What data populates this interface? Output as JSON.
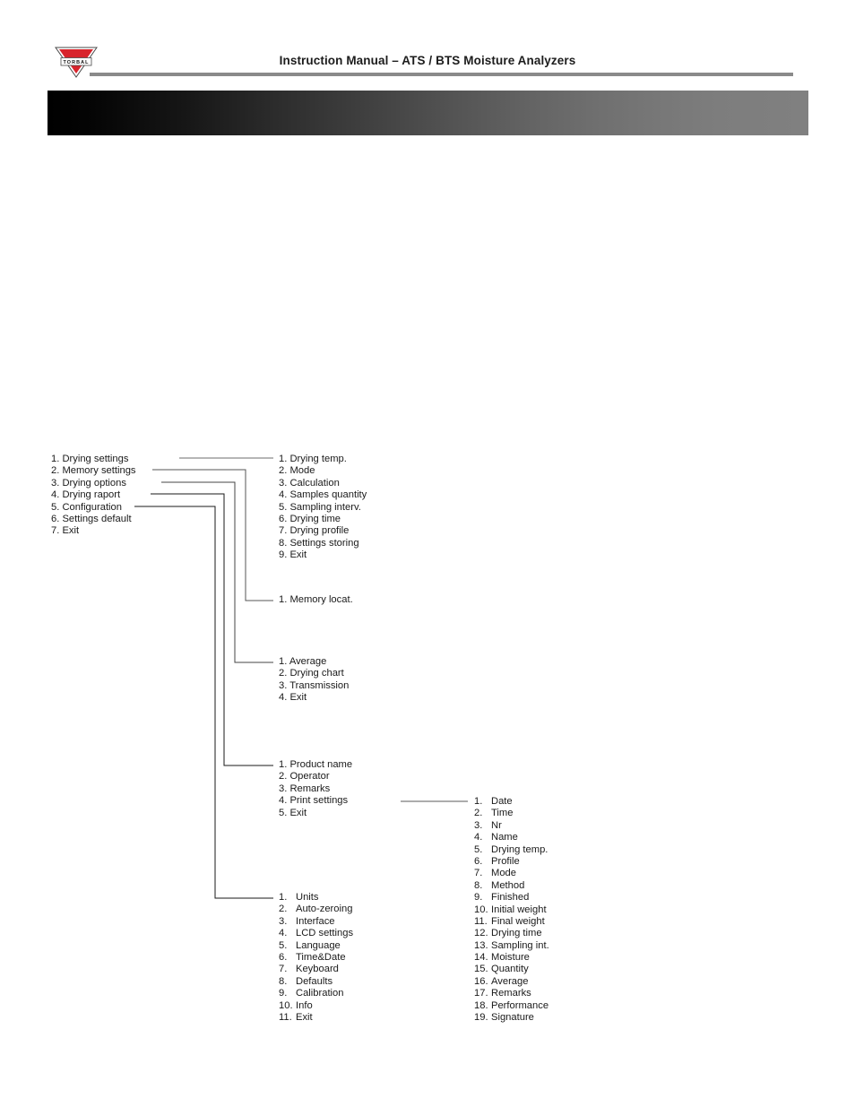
{
  "header": {
    "title": "Instruction Manual – ATS / BTS Moisture Analyzers",
    "logo_text": "TORBAL",
    "logo_color": "#d8242c",
    "rule_color": "#8a8a8a",
    "banner_gradient_from": "#000000",
    "banner_gradient_to": "#808080"
  },
  "diagram": {
    "type": "menu-tree",
    "root_menu": {
      "name": "main-menu",
      "items": [
        {
          "num": "1.",
          "label": "Drying settings"
        },
        {
          "num": "2.",
          "label": "Memory settings"
        },
        {
          "num": "3.",
          "label": "Drying options"
        },
        {
          "num": "4.",
          "label": "Drying raport"
        },
        {
          "num": "5.",
          "label": "Configuration"
        },
        {
          "num": "6.",
          "label": "Settings default"
        },
        {
          "num": "7.",
          "label": "Exit"
        }
      ]
    },
    "drying_settings": {
      "name": "drying-settings-menu",
      "items": [
        {
          "num": "1.",
          "label": "Drying temp."
        },
        {
          "num": "2.",
          "label": "Mode"
        },
        {
          "num": "3.",
          "label": "Calculation"
        },
        {
          "num": "4.",
          "label": "Samples quantity"
        },
        {
          "num": "5.",
          "label": "Sampling interv."
        },
        {
          "num": "6.",
          "label": "Drying time"
        },
        {
          "num": "7.",
          "label": "Drying profile"
        },
        {
          "num": "8.",
          "label": "Settings storing"
        },
        {
          "num": "9.",
          "label": "Exit"
        }
      ]
    },
    "memory_settings": {
      "name": "memory-settings-menu",
      "items": [
        {
          "num": "1.",
          "label": "Memory locat."
        }
      ]
    },
    "drying_options": {
      "name": "drying-options-menu",
      "items": [
        {
          "num": "1.",
          "label": "Average"
        },
        {
          "num": "2.",
          "label": "Drying chart"
        },
        {
          "num": "3.",
          "label": "Transmission"
        },
        {
          "num": "4.",
          "label": "Exit"
        }
      ]
    },
    "drying_report": {
      "name": "drying-report-menu",
      "items": [
        {
          "num": "1.",
          "label": "Product name"
        },
        {
          "num": "2.",
          "label": "Operator"
        },
        {
          "num": "3.",
          "label": "Remarks"
        },
        {
          "num": "4.",
          "label": "Print settings"
        },
        {
          "num": "5.",
          "label": "Exit"
        }
      ]
    },
    "configuration": {
      "name": "configuration-menu",
      "items": [
        {
          "num": "1.",
          "label": "Units"
        },
        {
          "num": "2.",
          "label": "Auto-zeroing"
        },
        {
          "num": "3.",
          "label": "Interface"
        },
        {
          "num": "4.",
          "label": "LCD settings"
        },
        {
          "num": "5.",
          "label": "Language"
        },
        {
          "num": "6.",
          "label": "Time&Date"
        },
        {
          "num": "7.",
          "label": "Keyboard"
        },
        {
          "num": "8.",
          "label": "Defaults"
        },
        {
          "num": "9.",
          "label": "Calibration"
        },
        {
          "num": "10.",
          "label": "Info"
        },
        {
          "num": "11.",
          "label": "Exit"
        }
      ]
    },
    "print_settings": {
      "name": "print-settings-menu",
      "items": [
        {
          "num": "1.",
          "label": "Date"
        },
        {
          "num": "2.",
          "label": "Time"
        },
        {
          "num": "3.",
          "label": "Nr"
        },
        {
          "num": "4.",
          "label": "Name"
        },
        {
          "num": "5.",
          "label": "Drying temp."
        },
        {
          "num": "6.",
          "label": "Profile"
        },
        {
          "num": "7.",
          "label": "Mode"
        },
        {
          "num": "8.",
          "label": "Method"
        },
        {
          "num": "9.",
          "label": "Finished"
        },
        {
          "num": "10.",
          "label": "Initial weight"
        },
        {
          "num": "11.",
          "label": "Final weight"
        },
        {
          "num": "12.",
          "label": "Drying time"
        },
        {
          "num": "13.",
          "label": "Sampling int."
        },
        {
          "num": "14.",
          "label": "Moisture"
        },
        {
          "num": "15.",
          "label": "Quantity"
        },
        {
          "num": "16.",
          "label": "Average"
        },
        {
          "num": "17.",
          "label": "Remarks"
        },
        {
          "num": "18.",
          "label": "Performance"
        },
        {
          "num": "19.",
          "label": "Signature"
        }
      ]
    }
  }
}
